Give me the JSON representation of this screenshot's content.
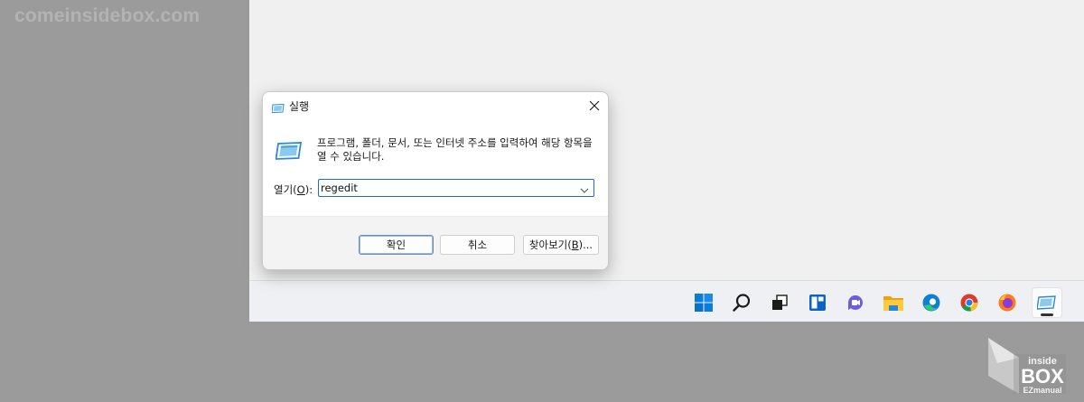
{
  "watermark": "comeinsidebox.com",
  "dialog": {
    "title": "실행",
    "description": "프로그램, 폴더, 문서, 또는 인터넷 주소를 입력하여 해당 항목을 열 수 있습니다.",
    "open_label_prefix": "열기(",
    "open_label_key": "O",
    "open_label_suffix": "):",
    "input_value": "regedit",
    "ok_label": "확인",
    "cancel_label": "취소",
    "browse_prefix": "찾아보기(",
    "browse_key": "B",
    "browse_suffix": ")..."
  },
  "taskbar": {
    "icons": [
      "windows-start-icon",
      "search-icon",
      "task-view-icon",
      "widgets-icon",
      "chat-icon",
      "file-explorer-icon",
      "edge-icon",
      "chrome-icon",
      "firefox-icon",
      "run-app-icon"
    ],
    "active": "run-app-icon"
  },
  "logo": {
    "line1": "inside",
    "line2": "BOX",
    "line3": "EZmanual"
  },
  "colors": {
    "accent": "#1f6fc5",
    "desktop": "#f0f0f0",
    "backdrop": "#9b9b9b"
  }
}
